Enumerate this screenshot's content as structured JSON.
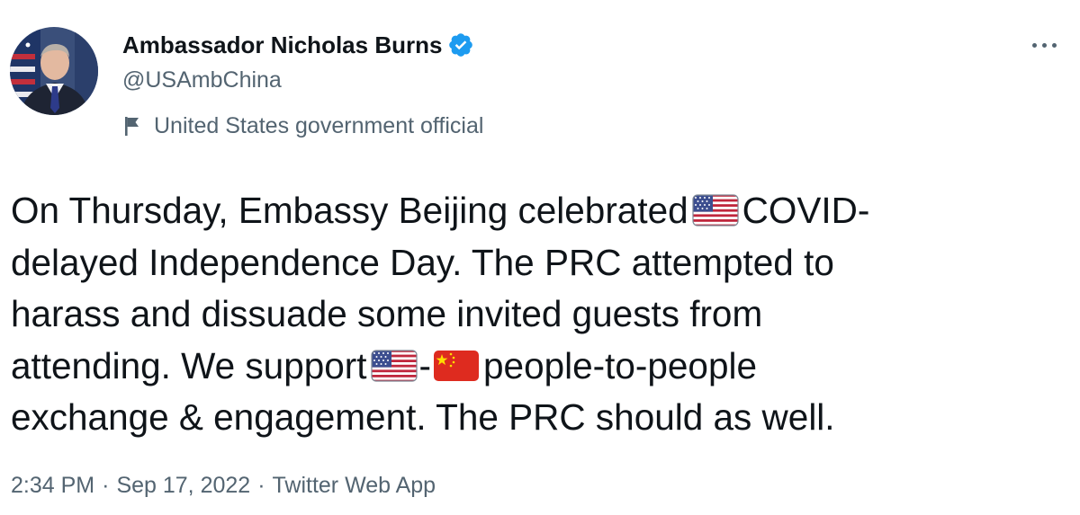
{
  "author": {
    "display_name": "Ambassador Nicholas Burns",
    "handle": "@USAmbChina",
    "label": "United States government official",
    "verified": true,
    "verified_color": "#1d9bf0"
  },
  "tweet": {
    "line1_a": "On Thursday, Embassy Beijing celebrated",
    "line1_b": "COVID-",
    "line2": "delayed Independence Day. The PRC attempted to",
    "line3": "harass and dissuade some invited guests from",
    "line4_a": "attending. We support",
    "line4_dash": "-",
    "line4_b": "people-to-people",
    "line5": "exchange & engagement. The PRC should as well.",
    "emojis": [
      "us-flag-emoji",
      "us-flag-emoji",
      "china-flag-emoji"
    ]
  },
  "meta": {
    "time": "2:34 PM",
    "separator": "·",
    "date": "Sep 17, 2022",
    "source": "Twitter Web App"
  },
  "colors": {
    "text": "#0f1419",
    "secondary": "#536471",
    "verified": "#1d9bf0"
  }
}
